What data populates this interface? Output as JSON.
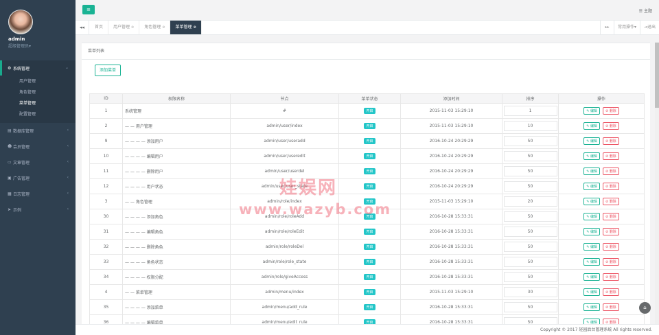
{
  "profile": {
    "name": "admin",
    "role": "超级管理员",
    "role_arrow": "▾"
  },
  "sidebar": {
    "items": [
      {
        "icon": "gear-icon",
        "glyph": "⚙",
        "label": "系统管理",
        "arrow": "⌄",
        "expanded": true,
        "children": [
          "用户管理",
          "角色管理",
          "菜单管理",
          "配置管理"
        ],
        "current": "菜单管理"
      },
      {
        "icon": "database-icon",
        "glyph": "▤",
        "label": "数据库管理",
        "arrow": "‹"
      },
      {
        "icon": "users-icon",
        "glyph": "☻",
        "label": "会员管理",
        "arrow": "‹"
      },
      {
        "icon": "document-icon",
        "glyph": "▭",
        "label": "文章管理",
        "arrow": "‹"
      },
      {
        "icon": "image-icon",
        "glyph": "▣",
        "label": "广告管理",
        "arrow": "‹"
      },
      {
        "icon": "log-icon",
        "glyph": "▦",
        "label": "日志管理",
        "arrow": "‹"
      },
      {
        "icon": "send-icon",
        "glyph": "➤",
        "label": "示例",
        "arrow": "‹"
      }
    ]
  },
  "topbar": {
    "menu_glyph": "≡",
    "theme_label": "主题",
    "theme_glyph": "☰"
  },
  "tabbar": {
    "prev_glyph": "◂◂",
    "tabs": [
      {
        "label": "首页",
        "close": ""
      },
      {
        "label": "用户管理",
        "close": "⊗"
      },
      {
        "label": "角色管理",
        "close": "⊗"
      },
      {
        "label": "菜单管理",
        "close": "⊗",
        "active": true
      }
    ],
    "next_glyph": "▸▸",
    "common_ops": "常用操作▾",
    "logout": "⇥退出"
  },
  "panel": {
    "title": "菜单列表",
    "add_button": "添加菜单"
  },
  "table": {
    "headers": [
      "ID",
      "权限名称",
      "节点",
      "菜单状态",
      "添加时间",
      "排序",
      "操作"
    ],
    "edit_label": "✎ 编辑",
    "delete_label": "⊘ 删除",
    "rows": [
      {
        "id": "1",
        "name": "系统管理",
        "node": "#",
        "status": "开启",
        "time": "2015-11-03 15:29:10",
        "sort": "1"
      },
      {
        "id": "2",
        "name": "— — 用户管理",
        "node": "admin/user/index",
        "status": "开启",
        "time": "2015-11-03 15:29:10",
        "sort": "10"
      },
      {
        "id": "9",
        "name": "— — — — 添加用户",
        "node": "admin/user/useradd",
        "status": "开启",
        "time": "2016-10-24 20:29:29",
        "sort": "50"
      },
      {
        "id": "10",
        "name": "— — — — 编辑用户",
        "node": "admin/user/useredit",
        "status": "开启",
        "time": "2016-10-24 20:29:29",
        "sort": "50"
      },
      {
        "id": "11",
        "name": "— — — — 删除用户",
        "node": "admin/user/userdel",
        "status": "开启",
        "time": "2016-10-24 20:29:29",
        "sort": "50"
      },
      {
        "id": "12",
        "name": "— — — — 用户状态",
        "node": "admin/user/user_state",
        "status": "开启",
        "time": "2016-10-24 20:29:29",
        "sort": "50"
      },
      {
        "id": "3",
        "name": "— — 角色管理",
        "node": "admin/role/index",
        "status": "开启",
        "time": "2015-11-03 15:29:10",
        "sort": "20"
      },
      {
        "id": "30",
        "name": "— — — — 添加角色",
        "node": "admin/role/roleAdd",
        "status": "开启",
        "time": "2016-10-28 15:33:31",
        "sort": "50"
      },
      {
        "id": "31",
        "name": "— — — — 编辑角色",
        "node": "admin/role/roleEdit",
        "status": "开启",
        "time": "2016-10-28 15:33:31",
        "sort": "50"
      },
      {
        "id": "32",
        "name": "— — — — 删除角色",
        "node": "admin/role/roleDel",
        "status": "开启",
        "time": "2016-10-28 15:33:31",
        "sort": "50"
      },
      {
        "id": "33",
        "name": "— — — — 角色状态",
        "node": "admin/role/role_state",
        "status": "开启",
        "time": "2016-10-28 15:33:31",
        "sort": "50"
      },
      {
        "id": "34",
        "name": "— — — — 权限分配",
        "node": "admin/role/giveAccess",
        "status": "开启",
        "time": "2016-10-28 15:33:31",
        "sort": "50"
      },
      {
        "id": "4",
        "name": "— — 菜单管理",
        "node": "admin/menu/index",
        "status": "开启",
        "time": "2015-11-03 15:29:10",
        "sort": "30"
      },
      {
        "id": "35",
        "name": "— — — — 添加菜单",
        "node": "admin/menu/add_rule",
        "status": "开启",
        "time": "2016-10-28 15:33:31",
        "sort": "50"
      },
      {
        "id": "36",
        "name": "— — — — 编辑菜单",
        "node": "admin/menu/edit_rule",
        "status": "开启",
        "time": "2016-10-28 15:33:31",
        "sort": "50"
      }
    ]
  },
  "watermark": {
    "line1": "娃娱网",
    "line2": "www.wazyb.com"
  },
  "footer": {
    "text": "Copyright © 2017 轻园后台管理系统 All rights reserved."
  },
  "home_glyph": "⌂",
  "colors": {
    "sidebar": "#2f4050",
    "accent": "#1ab394",
    "badge": "#23c6c8",
    "danger": "#ed5565"
  }
}
